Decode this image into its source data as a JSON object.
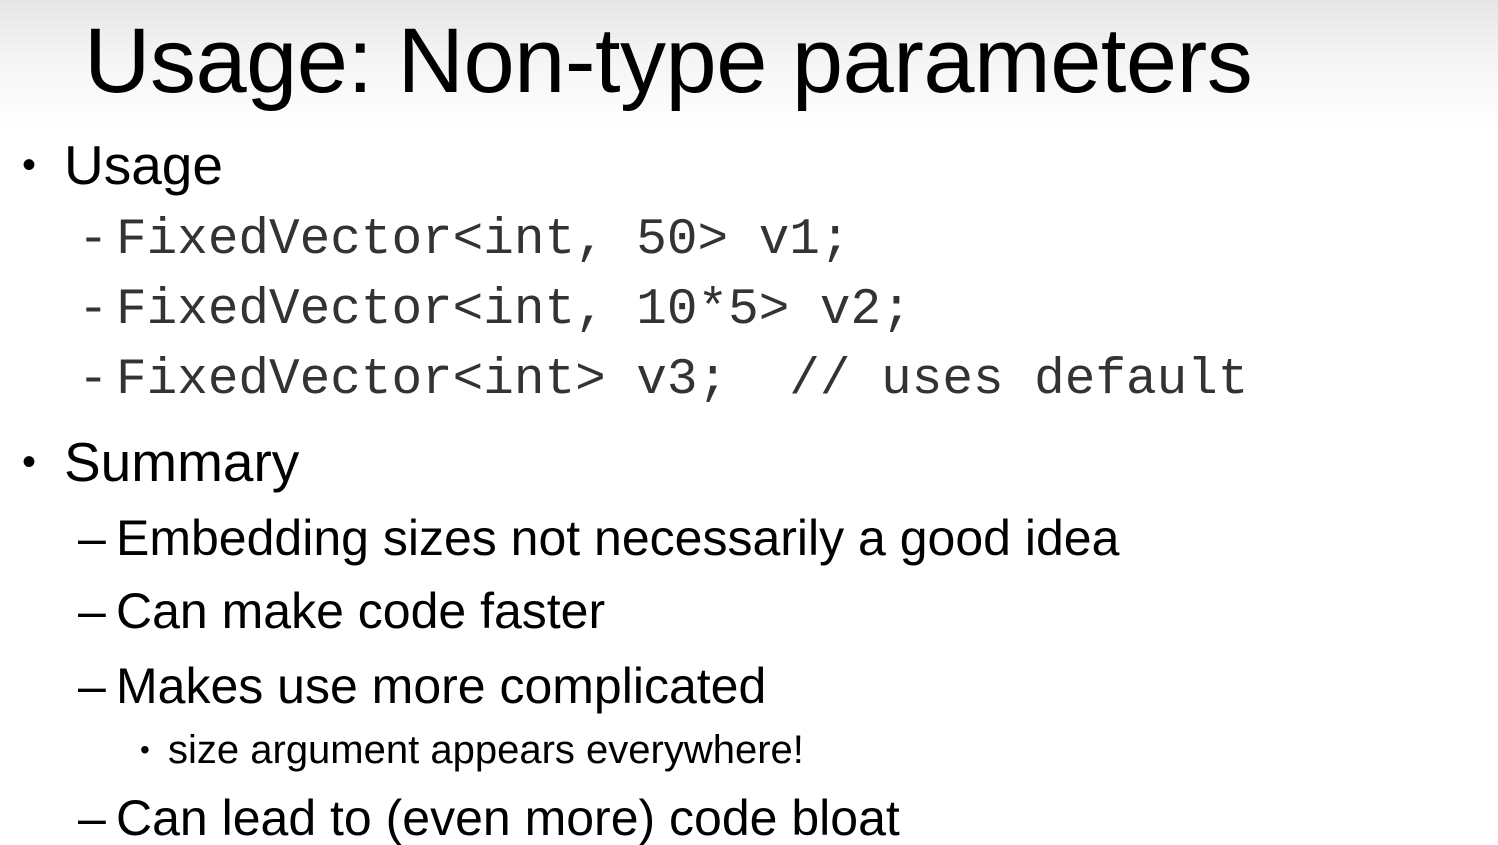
{
  "slide": {
    "title": "Usage: Non-type parameters",
    "sections": [
      {
        "bullet": "•",
        "heading": "Usage",
        "items": [
          {
            "dash": "-",
            "text": "FixedVector<int, 50> v1;"
          },
          {
            "dash": "-",
            "text": "FixedVector<int, 10*5> v2;"
          },
          {
            "dash": "-",
            "text": "FixedVector<int> v3;  // uses default"
          }
        ]
      },
      {
        "bullet": "•",
        "heading": "Summary",
        "items": [
          {
            "dash": "–",
            "text": "Embedding sizes not necessarily a good idea"
          },
          {
            "dash": "–",
            "text": "Can make code faster"
          },
          {
            "dash": "–",
            "text": "Makes use more complicated",
            "subitems": [
              {
                "bullet": "•",
                "text": "size argument appears everywhere!"
              }
            ]
          },
          {
            "dash": "–",
            "text": "Can lead to (even more) code bloat"
          }
        ]
      }
    ]
  }
}
